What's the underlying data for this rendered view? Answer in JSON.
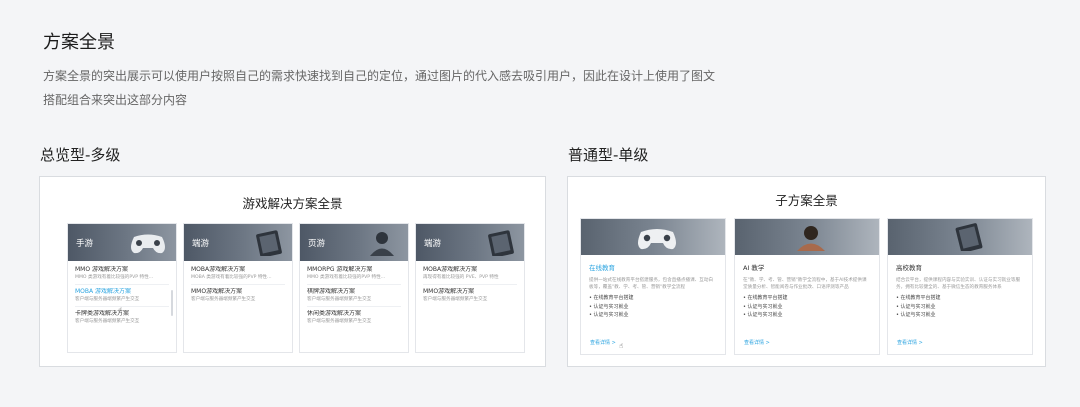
{
  "title": "方案全景",
  "description": "方案全景的突出展示可以使用户按照自己的需求快速找到自己的定位，通过图片的代入感去吸引用户，因此在设计上使用了图文搭配组合来突出这部分内容",
  "left_section": {
    "label": "总览型-多级",
    "panel_title": "游戏解决方案全景",
    "cards": [
      {
        "tag": "手游",
        "items": [
          {
            "title": "MMO 游戏解决方案",
            "sub": "MMO 类游戏有着比较强的PVP 特性…",
            "active": false
          },
          {
            "title": "MOBA 游戏解决方案",
            "sub": "客户端与服务器端频繁产生交互",
            "active": true
          },
          {
            "title": "卡牌类游戏解决方案",
            "sub": "客户端与服务器端频繁产生交互",
            "active": false
          }
        ]
      },
      {
        "tag": "端游",
        "items": [
          {
            "title": "MOBA游戏解决方案",
            "sub": "MOBA 类游戏有着比较强的PVP 特性…",
            "active": false
          },
          {
            "title": "MMO游戏解决方案",
            "sub": "客户端与服务器端频繁产生交互",
            "active": false
          }
        ]
      },
      {
        "tag": "页游",
        "items": [
          {
            "title": "MMORPG 游戏解决方案",
            "sub": "MMO 类游戏有着比较强的PVP 特性…",
            "active": false
          },
          {
            "title": "棋牌游戏解决方案",
            "sub": "客户端与服务器端频繁产生交互",
            "active": false
          },
          {
            "title": "休闲类游戏解决方案",
            "sub": "客户端与服务器端频繁产生交互",
            "active": false
          }
        ]
      },
      {
        "tag": "端游",
        "items": [
          {
            "title": "MOBA游戏解决方案",
            "sub": "再现得有着比较强的 PVE、PVP 特性",
            "active": false
          },
          {
            "title": "MMO游戏解决方案",
            "sub": "客户端与服务器端频繁产生交互",
            "active": false
          }
        ]
      }
    ]
  },
  "right_section": {
    "label": "普通型-单级",
    "panel_title": "子方案全景",
    "cards": [
      {
        "title": "在线教育",
        "active": true,
        "text": "提供一站式在线教育平台搭建服务，包含直播点播课、互动白板等，覆盖\"教、学、考、管、营销\"教学全流程",
        "bullets": [
          "• 在线教育平台搭建",
          "• 认证与实习就业",
          "• 认证与实习就业"
        ],
        "link": "查看详情 >"
      },
      {
        "title": "AI 教学",
        "active": false,
        "text": "在\"教、学、考、管、营销\"教学全流程中，基于AI技术提供课堂质量分析、智能阅卷与作业批改、口语评测等产品",
        "bullets": [
          "• 在线教育平台搭建",
          "• 认证与实习就业",
          "• 认证与实习就业"
        ],
        "link": "查看详情 >"
      },
      {
        "title": "高校教育",
        "active": false,
        "text": "结合云平台，提供课程内容与实验实训、认证与实习就业等服务，拥有比较健全的、基于微信生态的教育服务体系",
        "bullets": [
          "• 在线教育平台搭建",
          "• 认证与实习就业",
          "• 认证与实习就业"
        ],
        "link": "查看详情 >"
      }
    ]
  },
  "cursor_glyph": "☝"
}
